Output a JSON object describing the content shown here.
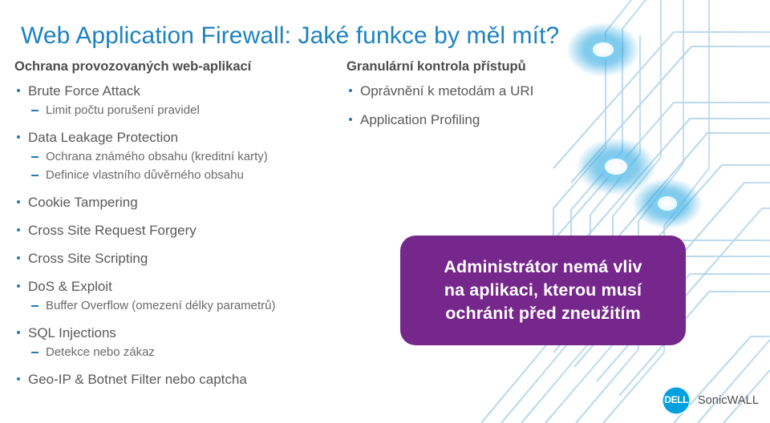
{
  "slide": {
    "title": "Web Application Firewall: Jaké funkce by měl mít?",
    "title_color": "#1d82c0",
    "background_color": "#ffffff"
  },
  "left_column": {
    "heading": "Ochrana provozovaných web-aplikací",
    "items": [
      {
        "label": "Brute Force Attack",
        "sub": [
          "Limit počtu porušení pravidel"
        ]
      },
      {
        "label": "Data Leakage Protection",
        "sub": [
          "Ochrana známého obsahu (kreditní karty)",
          "Definice vlastního důvěrného obsahu"
        ]
      },
      {
        "label": "Cookie Tampering",
        "sub": []
      },
      {
        "label": "Cross Site Request Forgery",
        "sub": []
      },
      {
        "label": "Cross Site Scripting",
        "sub": []
      },
      {
        "label": "DoS & Exploit",
        "sub": [
          "Buffer Overflow (omezení délky parametrů)"
        ]
      },
      {
        "label": "SQL Injections",
        "sub": [
          "Detekce nebo zákaz"
        ]
      },
      {
        "label": "Geo-IP & Botnet Filter nebo captcha",
        "sub": []
      }
    ]
  },
  "right_column": {
    "heading": "Granulární kontrola přístupů",
    "items": [
      {
        "label": "Oprávnění k metodám a URI",
        "sub": []
      },
      {
        "label": "Application Profiling",
        "sub": []
      }
    ]
  },
  "callout": {
    "lines": [
      "Administrátor nemá vliv",
      "na aplikaci, kterou musí",
      "ochránit před zneužitím"
    ],
    "background_color": "#76278c",
    "text_color": "#ffffff"
  },
  "logo": {
    "mark_text": "DELL",
    "word": "SonicWALL",
    "mark_color": "#00a0df",
    "word_color": "#4a4a4a"
  },
  "decor": {
    "line_color": "#bcd9ea",
    "node_glow_color": "#2ba6e0"
  }
}
